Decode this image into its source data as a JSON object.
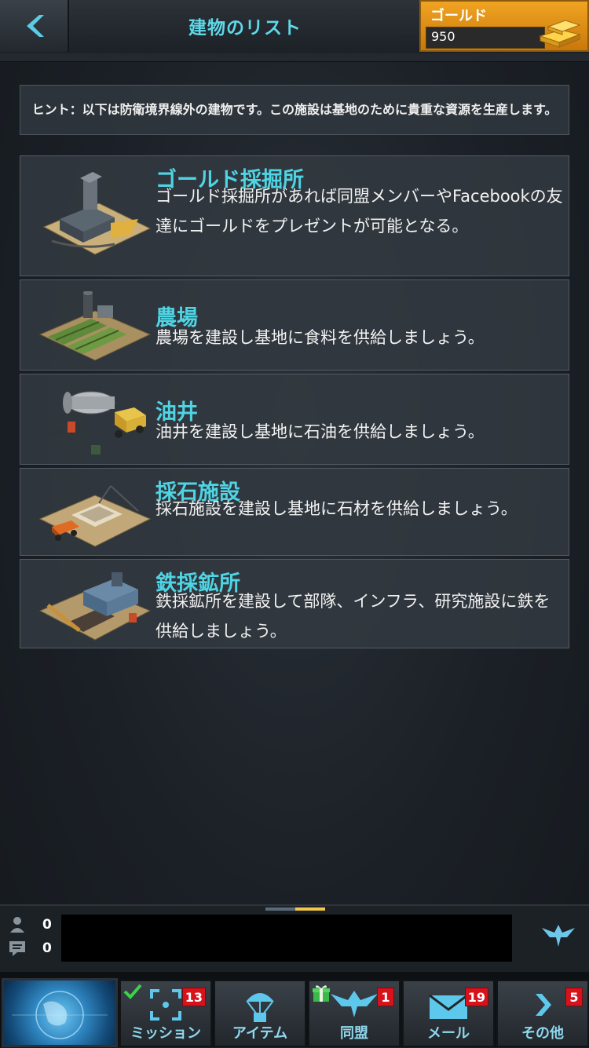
{
  "header": {
    "back_icon": "back-arrow-icon",
    "title": "建物のリスト",
    "gold_label": "ゴールド",
    "gold_value": "950",
    "gold_icon": "gold-bars-icon"
  },
  "hint": "ヒント：以下は防衛境界線外の建物です。この施設は基地のために貴重な資源を生産します。",
  "buildings": [
    {
      "title": "ゴールド採掘所",
      "desc": "ゴールド採掘所があれば同盟メンバーやFacebookの友達にゴールドをプレゼントが可能となる。",
      "icon": "gold-mine-icon"
    },
    {
      "title": "農場",
      "desc": "農場を建設し基地に食料を供給しましょう。",
      "icon": "farm-icon"
    },
    {
      "title": "油井",
      "desc": "油井を建設し基地に石油を供給しましょう。",
      "icon": "oil-well-icon"
    },
    {
      "title": "採石施設",
      "desc": "採石施設を建設し基地に石材を供給しましょう。",
      "icon": "quarry-icon"
    },
    {
      "title": "鉄採鉱所",
      "desc": "鉄採鉱所を建設して部隊、インフラ、研究施設に鉄を供給しましょう。",
      "icon": "iron-mine-icon"
    }
  ],
  "chat": {
    "players_count": "0",
    "messages_count": "0"
  },
  "nav": {
    "mission": {
      "label": "ミッション",
      "badge": "13"
    },
    "items": {
      "label": "アイテム"
    },
    "alliance": {
      "label": "同盟",
      "badge": "1"
    },
    "mail": {
      "label": "メール",
      "badge": "19"
    },
    "more": {
      "label": "その他",
      "badge": "5"
    }
  },
  "colors": {
    "accent": "#4fd4e4",
    "gold": "#f0a422",
    "badge": "#d8121a"
  }
}
